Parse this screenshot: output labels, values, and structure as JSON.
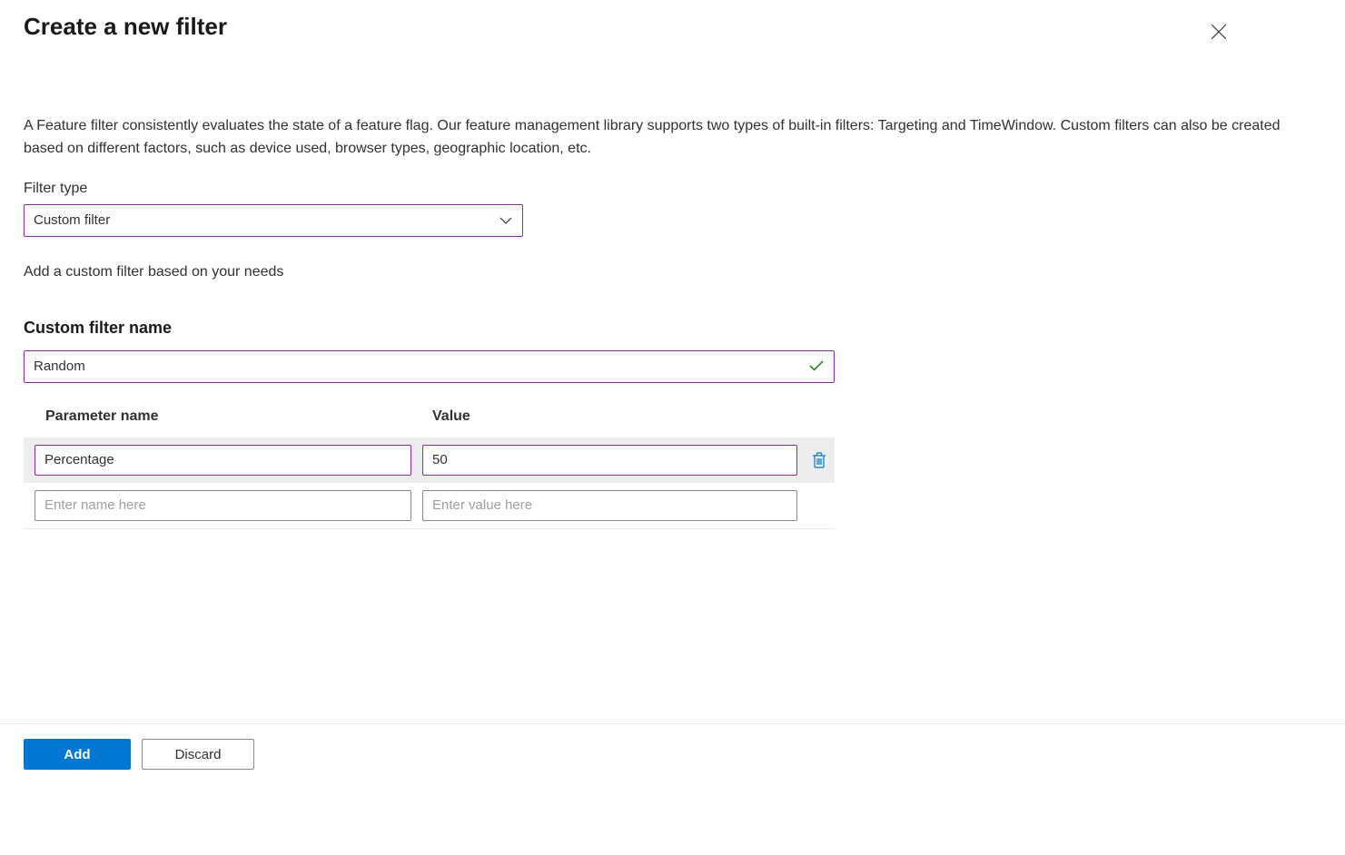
{
  "page": {
    "title": "Create a new filter",
    "description": "A Feature filter consistently evaluates the state of a feature flag. Our feature management library supports two types of built-in filters: Targeting and TimeWindow. Custom filters can also be created based on different factors, such as device used, browser types, geographic location, etc."
  },
  "filterType": {
    "label": "Filter type",
    "value": "Custom filter",
    "helperText": "Add a custom filter based on your needs"
  },
  "customFilterName": {
    "label": "Custom filter name",
    "value": "Random"
  },
  "paramsTable": {
    "headers": {
      "name": "Parameter name",
      "value": "Value"
    },
    "rows": [
      {
        "name": "Percentage",
        "value": "50"
      }
    ],
    "placeholders": {
      "name": "Enter name here",
      "value": "Enter value here"
    }
  },
  "footer": {
    "add": "Add",
    "discard": "Discard"
  }
}
